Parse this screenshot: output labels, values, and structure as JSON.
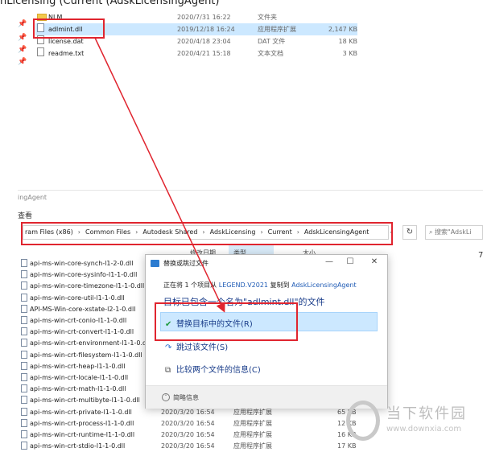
{
  "top_title": "nLicensing (Current (AdskLicensingAgent)",
  "top_files": [
    {
      "name": "NLM",
      "date": "2020/7/31 16:22",
      "type": "文件夹",
      "size": "",
      "icon": "folder-icon"
    },
    {
      "name": "adlmint.dll",
      "date": "2019/12/18 16:24",
      "type": "应用程序扩展",
      "size": "2,147 KB",
      "icon": "dll-file-icon"
    },
    {
      "name": "license.dat",
      "date": "2020/4/18 23:04",
      "type": "DAT 文件",
      "size": "18 KB",
      "icon": "file-icon"
    },
    {
      "name": "readme.txt",
      "date": "2020/4/21 15:18",
      "type": "文本文档",
      "size": "3 KB",
      "icon": "text-file-icon"
    }
  ],
  "window2": {
    "title": "ingAgent",
    "menu": "查看",
    "breadcrumb": [
      "ram Files (x86)",
      "Common Files",
      "Autodesk Shared",
      "AdskLicensing",
      "Current",
      "AdskLicensingAgent"
    ],
    "search_placeholder": "搜索\"AdskLi",
    "col_headers": {
      "date": "修改日期",
      "type": "类型",
      "size": "大小"
    },
    "right_number": "7",
    "files": [
      {
        "name": "api-ms-win-core-synch-l1-2-0.dll",
        "date": "",
        "type": "",
        "size": ""
      },
      {
        "name": "api-ms-win-core-sysinfo-l1-1-0.dll",
        "date": "",
        "type": "",
        "size": ""
      },
      {
        "name": "api-ms-win-core-timezone-l1-1-0.dll",
        "date": "",
        "type": "",
        "size": ""
      },
      {
        "name": "api-ms-win-core-util-l1-1-0.dll",
        "date": "",
        "type": "",
        "size": ""
      },
      {
        "name": "API-MS-Win-core-xstate-l2-1-0.dll",
        "date": "",
        "type": "",
        "size": ""
      },
      {
        "name": "api-ms-win-crt-conio-l1-1-0.dll",
        "date": "",
        "type": "",
        "size": ""
      },
      {
        "name": "api-ms-win-crt-convert-l1-1-0.dll",
        "date": "",
        "type": "",
        "size": ""
      },
      {
        "name": "api-ms-win-crt-environment-l1-1-0.dll",
        "date": "",
        "type": "",
        "size": ""
      },
      {
        "name": "api-ms-win-crt-filesystem-l1-1-0.dll",
        "date": "",
        "type": "",
        "size": ""
      },
      {
        "name": "api-ms-win-crt-heap-l1-1-0.dll",
        "date": "",
        "type": "",
        "size": ""
      },
      {
        "name": "api-ms-win-crt-locale-l1-1-0.dll",
        "date": "",
        "type": "",
        "size": ""
      },
      {
        "name": "api-ms-win-crt-math-l1-1-0.dll",
        "date": "",
        "type": "",
        "size": ""
      },
      {
        "name": "api-ms-win-crt-multibyte-l1-1-0.dll",
        "date": "",
        "type": "",
        "size": ""
      },
      {
        "name": "api-ms-win-crt-private-l1-1-0.dll",
        "date": "2020/3/20 16:54",
        "type": "应用程序扩展",
        "size": "65 KB"
      },
      {
        "name": "api-ms-win-crt-process-l1-1-0.dll",
        "date": "2020/3/20 16:54",
        "type": "应用程序扩展",
        "size": "12 KB"
      },
      {
        "name": "api-ms-win-crt-runtime-l1-1-0.dll",
        "date": "2020/3/20 16:54",
        "type": "应用程序扩展",
        "size": "16 KB"
      },
      {
        "name": "api-ms-win-crt-stdio-l1-1-0.dll",
        "date": "2020/3/20 16:54",
        "type": "应用程序扩展",
        "size": "17 KB"
      }
    ]
  },
  "dialog": {
    "title": "替换或跳过文件",
    "status_prefix": "正在将 1 个项目从",
    "status_source": "LEGEND.V2021",
    "status_mid": "复制到",
    "status_dest": "AdskLicensingAgent",
    "question": "目标已包含一个名为\"adlmint.dll\"的文件",
    "options": [
      {
        "label": "替换目标中的文件(R)",
        "icon": "checkmark-icon"
      },
      {
        "label": "跳过该文件(S)",
        "icon": "skip-arrow-icon"
      },
      {
        "label": "比较两个文件的信息(C)",
        "icon": "compare-icon"
      }
    ],
    "footer": "简略信息",
    "minimize_icon": "minimize-icon",
    "maximize_icon": "maximize-icon",
    "close_icon": "close-icon"
  },
  "watermark": {
    "name": "当下软件园",
    "url": "www.downxia.com"
  },
  "colors": {
    "annotation_red": "#e0252f",
    "selection_blue": "#cce8ff",
    "link_blue": "#1a3d8a"
  }
}
